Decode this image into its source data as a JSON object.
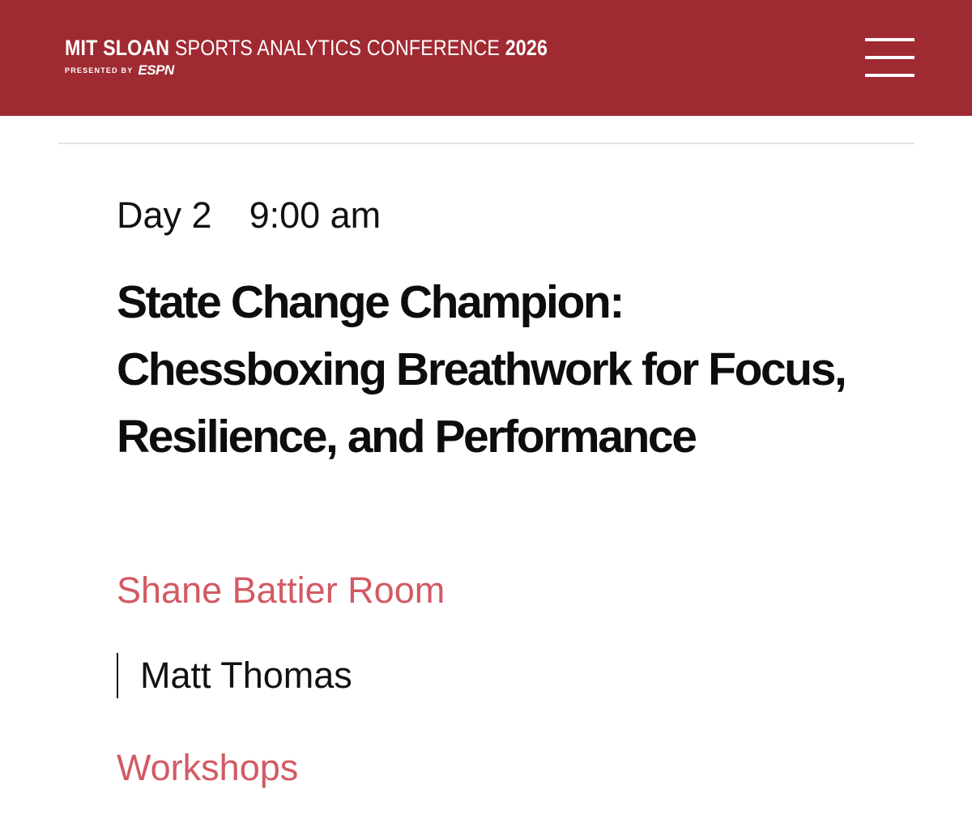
{
  "header": {
    "brand_part1": "MIT SLOAN",
    "brand_part2": " SPORTS ANALYTICS CONFERENCE ",
    "brand_part3": "2026",
    "presented_by": "PRESENTED BY",
    "sponsor": "ESPN",
    "menu_icon": "hamburger-menu-icon",
    "background_color": "#a02a32"
  },
  "session": {
    "day": "Day 2",
    "time": "9:00 am",
    "title": "State Change Champion: Chessboxing Breathwork for Focus, Resilience, and Performance",
    "room": "Shane Battier Room",
    "speaker": "Matt Thomas",
    "track": "Workshops",
    "link_color": "#d25a64"
  }
}
